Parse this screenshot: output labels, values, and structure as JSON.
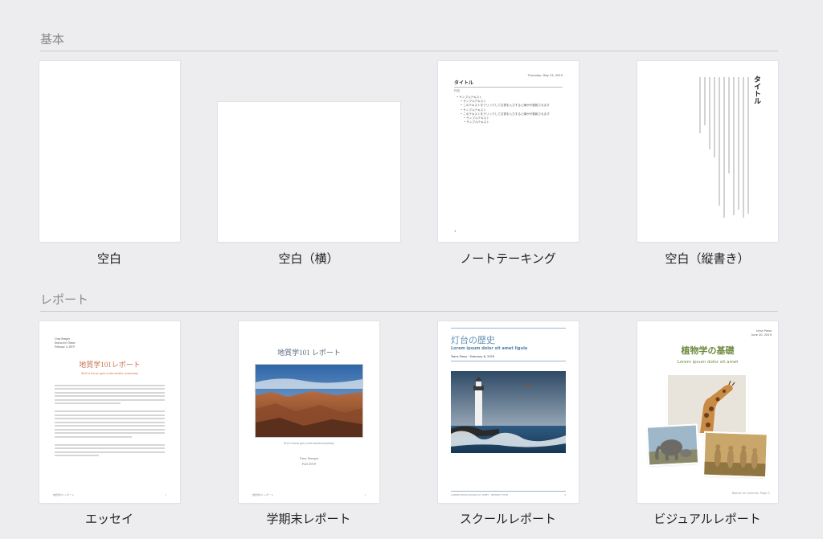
{
  "sections": {
    "basic": {
      "title": "基本"
    },
    "report": {
      "title": "レポート"
    }
  },
  "templates": {
    "blank": {
      "label": "空白"
    },
    "blank_landscape": {
      "label": "空白（横）"
    },
    "note_taking": {
      "label": "ノートテーキング",
      "date": "Thursday, May 23, 2019",
      "title": "タイトル",
      "author": "作名",
      "items": [
        "サンプルテキスト",
        "サンプルテキスト",
        "このテキストをクリックして文書を入力すると線がが更新されます",
        "サンプルテキスト",
        "このテキストをクリックして文書を入力すると線がが更新されます",
        "サンプルテキスト",
        "サンプルテキスト"
      ],
      "page_number": "1"
    },
    "blank_vertical": {
      "label": "空白（縦書き）",
      "title": "タイトル"
    },
    "essay": {
      "label": "エッセイ",
      "author_block": [
        "Urna Semper",
        "Instructor's Name",
        "February 4, 2019"
      ],
      "title": "地質学101レポート",
      "subtitle": "Sed et lacus quis enim mattis nonummy",
      "footer_left": "地質学101 レポート",
      "footer_right": "1"
    },
    "term_paper": {
      "label": "学期末レポート",
      "title": "地質学101 レポート",
      "caption": "Sed et lacus quis enim mattis nonummy",
      "author": "Urna Semper",
      "term": "Fall 2019",
      "footer_left": "地質学101 レポート",
      "footer_right": "1"
    },
    "school_report": {
      "label": "スクールレポート",
      "title": "灯台の歴史",
      "subtitle": "Lorem ipsum dolor sit amet ligula",
      "byline": "Trans Press · February 6, 2019",
      "footer_left": "LOREM IPSUM DOLOR SIT AMET · REPORT TITLE",
      "footer_right": "1"
    },
    "visual_report": {
      "label": "ビジュアルレポート",
      "corner": [
        "Urna Press",
        "June 20, 2019"
      ],
      "title": "植物学の基礎",
      "subtitle": "Lorem ipsum dolor sit amet",
      "footer": "Report on Animals, Page 1"
    }
  },
  "colors": {
    "background": "#ededf0",
    "essay_title": "#c8734e",
    "term_title": "#5a6a80",
    "school_title": "#5f8fb3",
    "visual_title": "#6d8a3e"
  }
}
